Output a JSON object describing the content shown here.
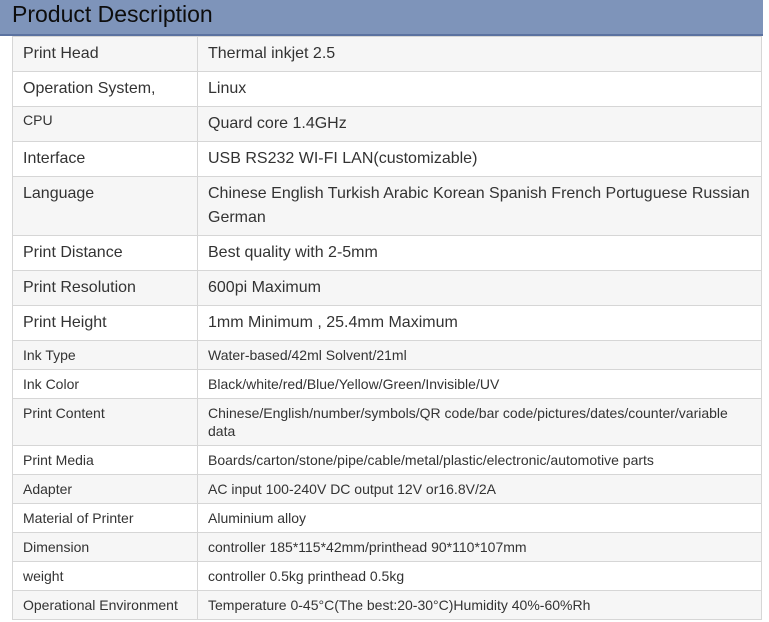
{
  "header": {
    "title": "Product Description"
  },
  "rows": [
    {
      "label": "Print Head",
      "value": "Thermal inkjet 2.5"
    },
    {
      "label": "Operation System,",
      "value": "Linux"
    },
    {
      "label": "CPU",
      "value": "Quard core 1.4GHz"
    },
    {
      "label": "Interface",
      "value": "USB RS232 WI-FI LAN(customizable)"
    },
    {
      "label": "Language",
      "value": "Chinese English Turkish Arabic Korean Spanish French Portuguese Russian German"
    },
    {
      "label": "Print Distance",
      "value": "Best quality with 2-5mm"
    },
    {
      "label": "Print Resolution",
      "value": "600pi Maximum"
    },
    {
      "label": "Print Height",
      "value": "1mm Minimum , 25.4mm Maximum"
    },
    {
      "label": "Ink Type",
      "value": "Water-based/42ml Solvent/21ml"
    },
    {
      "label": "Ink Color",
      "value": "Black/white/red/Blue/Yellow/Green/Invisible/UV"
    },
    {
      "label": "Print Content",
      "value": "Chinese/English/number/symbols/QR code/bar code/pictures/dates/counter/variable data"
    },
    {
      "label": "Print Media",
      "value": "Boards/carton/stone/pipe/cable/metal/plastic/electronic/automotive parts"
    },
    {
      "label": "Adapter",
      "value": "AC input 100-240V DC output 12V or16.8V/2A"
    },
    {
      "label": "Material of Printer",
      "value": "Aluminium alloy"
    },
    {
      "label": "Dimension",
      "value": "controller 185*115*42mm/printhead 90*110*107mm"
    },
    {
      "label": "weight",
      "value": "controller 0.5kg printhead 0.5kg"
    },
    {
      "label": "Operational Environment",
      "value": "Temperature 0-45°C(The best:20-30°C)Humidity 40%-60%Rh"
    }
  ]
}
